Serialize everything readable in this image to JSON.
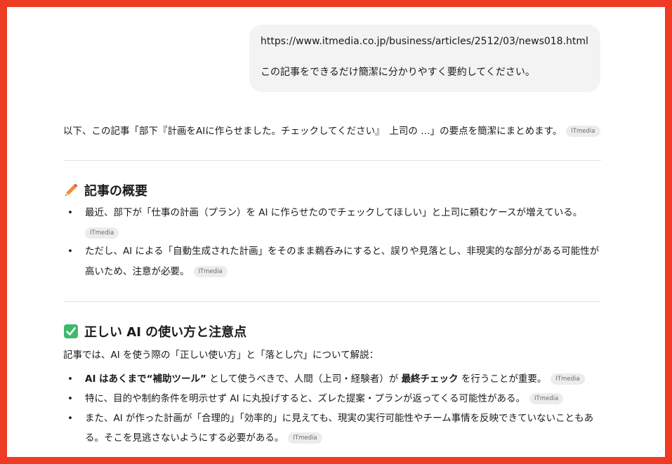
{
  "user_message": {
    "url": "https://www.itmedia.co.jp/business/articles/2512/03/news018.html",
    "request": "この記事をできるだけ簡潔に分かりやすく要約してください。"
  },
  "intro_text": "以下、この記事「部下『計画をAIに作らせました。チェックしてください』　上司の …」の要点を簡潔にまとめます。",
  "source_badge": "ITmedia",
  "section1": {
    "icon": "pencil-icon",
    "title": "記事の概要",
    "bullets": [
      {
        "line1": "最近、部下が「仕事の計画（プラン）を AI に作らせたのでチェックしてほしい」と上司に頼むケースが増えている。"
      },
      {
        "line1": "ただし、AI による「自動生成された計画」をそのまま鵜呑みにすると、誤りや見落とし、非現実的な部分がある可能性が",
        "line2": "高いため、注意が必要。"
      }
    ]
  },
  "section2": {
    "icon": "check-mark-icon",
    "title": "正しい AI の使い方と注意点",
    "intro": "記事では、AI を使う際の「正しい使い方」と「落とし穴」について解説：",
    "bullet1": {
      "b1": "AI はあくまで“補助ツール”",
      "t1": " として使うべきで、人間（上司・経験者）が ",
      "b2": "最終チェック",
      "t2": " を行うことが重要。"
    },
    "bullet2": "特に、目的や制約条件を明示せず AI に丸投げすると、ズレた提案・プランが返ってくる可能性がある。",
    "bullet3": {
      "line1": "また、AI が作った計画が「合理的」「効率的」に見えても、現実の実行可能性やチーム事情を反映できていないこともあ",
      "line2": "る。そこを見逃さないようにする必要がある。"
    }
  },
  "colors": {
    "frame": "#ee3b24",
    "bubble": "#f3f3f3",
    "badge_bg": "#ececec",
    "check_green": "#3dbb6b",
    "pencil_orange": "#f08a3c"
  }
}
